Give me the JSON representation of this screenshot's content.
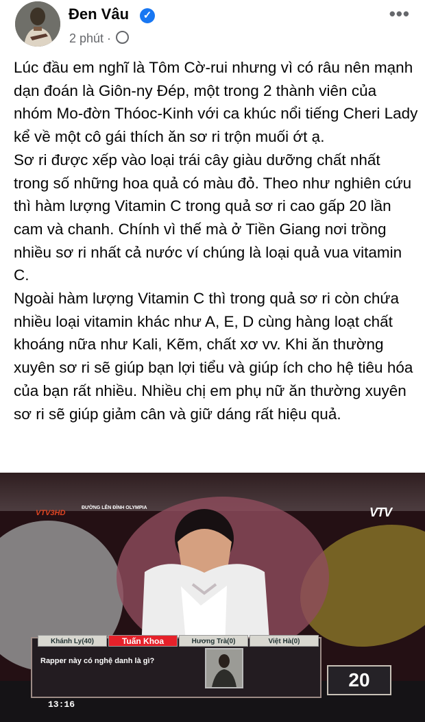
{
  "post": {
    "author": "Đen Vâu",
    "verified_icon": "verified-icon",
    "time": "2 phút",
    "privacy_icon": "globe-icon",
    "more_label": "•••",
    "paragraphs": [
      "Lúc đầu em nghĩ là Tôm Cờ-rui nhưng vì có râu nên mạnh dạn đoán là Giôn-ny Đép, một trong 2 thành viên của nhóm Mo-đờn Thóoc-Kinh với ca khúc nổi tiếng Cheri Lady kể về một cô gái thích ăn sơ ri trộn muối ớt ạ.",
      "Sơ ri được xếp vào loại trái cây giàu dưỡng chất nhất trong số những hoa quả có màu đỏ. Theo như nghiên cứu thì hàm lượng Vitamin C trong quả sơ ri cao gấp 20 lần cam và chanh. Chính vì thế mà ở Tiền Giang nơi trồng nhiều sơ ri nhất cả nước ví chúng là loại quả vua vitamin C.",
      "Ngoài hàm lượng Vitamin C thì trong quả sơ ri còn chứa nhiều loại vitamin khác như A, E, D cùng hàng loạt chất khoáng nữa như Kali, Kẽm, chất xơ vv. Khi ăn thường xuyên sơ ri sẽ giúp bạn lợi tiểu và giúp ích cho hệ tiêu hóa của bạn rất nhiều. Nhiều chị em phụ nữ ăn thường xuyên sơ ri sẽ giúp giảm cân và giữ dáng rất hiệu quả."
    ]
  },
  "video": {
    "channel_logo": "VTV3",
    "channel_hd": "HD",
    "show_name": "ĐƯỜNG LÊN ĐỈNH OLYMPIA",
    "vtv_logo": "VTV",
    "players": [
      "Khánh Ly(40)",
      "Tuấn Khoa",
      "Hương Trà(0)",
      "Việt Hà(0)"
    ],
    "question": "Rapper này có nghệ danh là gì?",
    "countdown": "20",
    "clock": "13:16"
  }
}
